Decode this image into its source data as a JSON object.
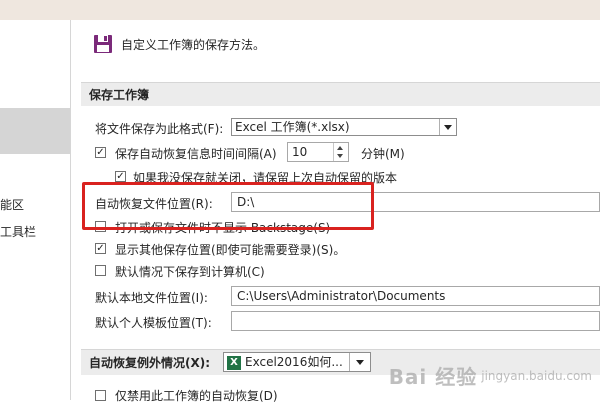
{
  "sidebar": {
    "items": [
      {
        "label": "能区"
      },
      {
        "label": "工具栏"
      }
    ]
  },
  "header": {
    "title": "自定义工作簿的保存方法。"
  },
  "save_section": {
    "title": "保存工作簿",
    "format_label": "将文件保存为此格式(F):",
    "format_value": "Excel 工作簿(*.xlsx)",
    "autorecover_label": "保存自动恢复信息时间间隔(A)",
    "autorecover_minutes": "10",
    "minutes_unit": "分钟(M)",
    "keep_last_label": "如果我没保存就关闭，请保留上次自动保留的版本",
    "autorecover_location_label": "自动恢复文件位置(R):",
    "autorecover_location_value": "D:\\",
    "no_backstage_label": "打开或保存文件时不显示 Backstage(S)",
    "show_other_locations_label": "显示其他保存位置(即使可能需要登录)(S)。",
    "save_to_computer_label": "默认情况下保存到计算机(C)",
    "default_local_label": "默认本地文件位置(I):",
    "default_local_value": "C:\\Users\\Administrator\\Documents",
    "default_template_label": "默认个人模板位置(T):",
    "default_template_value": ""
  },
  "exceptions_section": {
    "title": "自动恢复例外情况(X):",
    "workbook_value": "Excel2016如何...",
    "disable_label": "仅禁用此工作簿的自动恢复(D)"
  },
  "states": {
    "autorecover_checked": true,
    "keep_last_checked": true,
    "no_backstage_checked": false,
    "show_other_locations_checked": true,
    "save_to_computer_checked": false,
    "disable_checked": false
  },
  "watermark": {
    "main": "Bai 经验",
    "sub": "jingyan.baidu.com"
  },
  "colors": {
    "highlight": "#d9221f",
    "section_bg": "#ececec",
    "sidebar_selected": "#d5d5d5",
    "save_icon": "#7b2a7a",
    "excel_green": "#217346"
  }
}
